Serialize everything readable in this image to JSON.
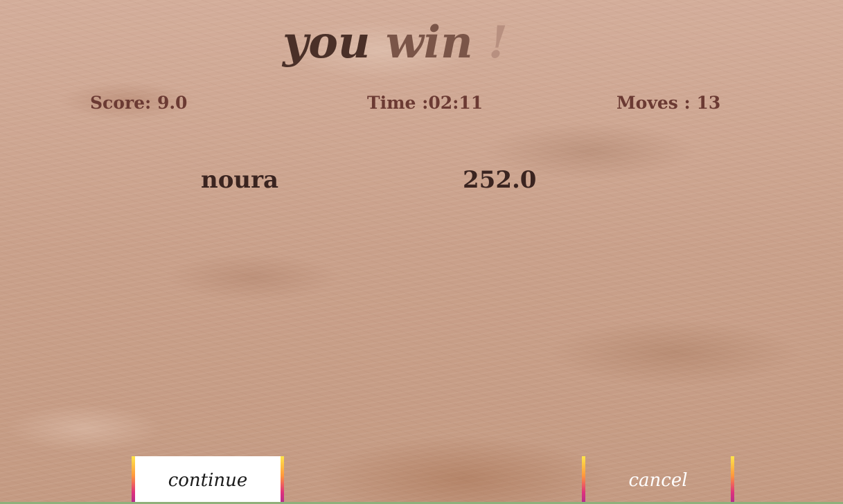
{
  "title": {
    "part1": "you",
    "part2": "win",
    "part3": "!"
  },
  "stats": {
    "score": "Score:  9.0",
    "time": "Time :02:11",
    "moves": "Moves :  13"
  },
  "player": {
    "name": "noura",
    "score": "252.0"
  },
  "buttons": {
    "continue_label": "continue",
    "cancel_label": "cancel"
  },
  "colors": {
    "stat_text": "#6b3a33",
    "player_text": "#3a2420",
    "button_accent_top": "#ffe64a",
    "button_accent_bottom": "#b02a90"
  }
}
